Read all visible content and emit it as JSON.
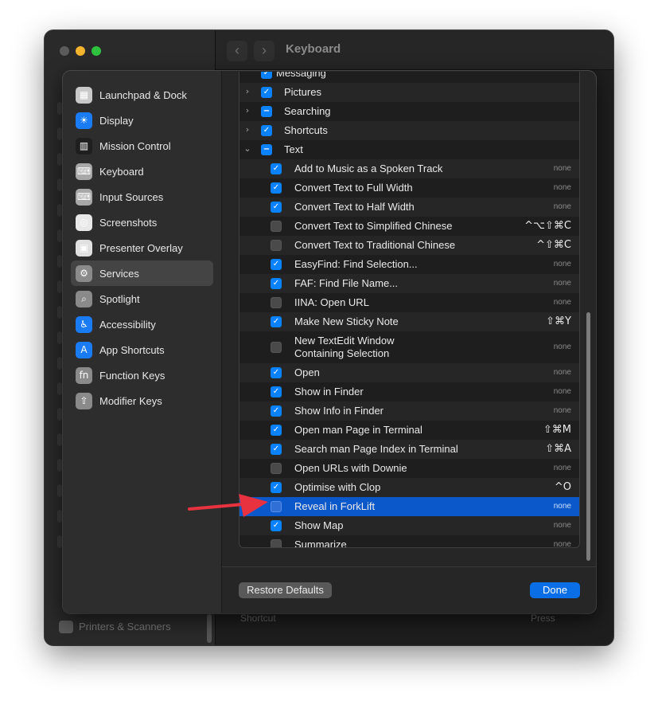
{
  "window": {
    "title": "Keyboard",
    "back_glyph": "‹",
    "forward_glyph": "›",
    "peek_shortcut_label": "Shortcut",
    "peek_press_label": "Press",
    "peek_printers_label": "Printers & Scanners"
  },
  "sidebar": {
    "items": [
      {
        "label": "Launchpad & Dock",
        "icon": "launchpad-dock-icon",
        "glyph": "▦",
        "color": "#c9c9c9"
      },
      {
        "label": "Display",
        "icon": "display-brightness-icon",
        "glyph": "☀",
        "color": "#1a7cf5"
      },
      {
        "label": "Mission Control",
        "icon": "mission-control-icon",
        "glyph": "▥",
        "color": "#1f1f1f"
      },
      {
        "label": "Keyboard",
        "icon": "keyboard-icon",
        "glyph": "⌨",
        "color": "#a8a8a8"
      },
      {
        "label": "Input Sources",
        "icon": "input-sources-icon",
        "glyph": "⌨",
        "color": "#a8a8a8"
      },
      {
        "label": "Screenshots",
        "icon": "screenshot-icon",
        "glyph": "◎",
        "color": "#e8e8e8"
      },
      {
        "label": "Presenter Overlay",
        "icon": "presenter-overlay-icon",
        "glyph": "▣",
        "color": "#e0e0e0"
      },
      {
        "label": "Services",
        "icon": "gears-icon",
        "glyph": "⚙",
        "color": "#8a8a8a"
      },
      {
        "label": "Spotlight",
        "icon": "spotlight-magnifier-icon",
        "glyph": "⌕",
        "color": "#8a8a8a"
      },
      {
        "label": "Accessibility",
        "icon": "accessibility-icon",
        "glyph": "♿",
        "color": "#1a7cf5"
      },
      {
        "label": "App Shortcuts",
        "icon": "app-shortcuts-icon",
        "glyph": "A",
        "color": "#1a7cf5"
      },
      {
        "label": "Function Keys",
        "icon": "function-keys-icon",
        "glyph": "fn",
        "color": "#8a8a8a"
      },
      {
        "label": "Modifier Keys",
        "icon": "modifier-keys-icon",
        "glyph": "⇧",
        "color": "#8a8a8a"
      }
    ],
    "selected_index": 7
  },
  "services_list": {
    "partial_top_label": "Messaging",
    "groups": [
      {
        "label": "Pictures",
        "state": "on",
        "expanded": false
      },
      {
        "label": "Searching",
        "state": "mixed",
        "expanded": false
      },
      {
        "label": "Shortcuts",
        "state": "on",
        "expanded": false
      },
      {
        "label": "Text",
        "state": "mixed",
        "expanded": true
      }
    ],
    "items": [
      {
        "label": "Add to Music as a Spoken Track",
        "checked": true,
        "shortcut": "none"
      },
      {
        "label": "Convert Text to Full Width",
        "checked": true,
        "shortcut": "none"
      },
      {
        "label": "Convert Text to Half Width",
        "checked": true,
        "shortcut": "none"
      },
      {
        "label": "Convert Text to Simplified Chinese",
        "checked": false,
        "shortcut": "^⌥⇧⌘C"
      },
      {
        "label": "Convert Text to Traditional Chinese",
        "checked": false,
        "shortcut": "^⇧⌘C"
      },
      {
        "label": "EasyFind: Find Selection...",
        "checked": true,
        "shortcut": "none"
      },
      {
        "label": "FAF: Find File Name...",
        "checked": true,
        "shortcut": "none"
      },
      {
        "label": "IINA: Open URL",
        "checked": false,
        "shortcut": "none"
      },
      {
        "label": "Make New Sticky Note",
        "checked": true,
        "shortcut": "⇧⌘Y"
      },
      {
        "label_line1": "New TextEdit Window",
        "label_line2": "Containing Selection",
        "checked": false,
        "shortcut": "none"
      },
      {
        "label": "Open",
        "checked": true,
        "shortcut": "none"
      },
      {
        "label": "Show in Finder",
        "checked": true,
        "shortcut": "none"
      },
      {
        "label": "Show Info in Finder",
        "checked": true,
        "shortcut": "none"
      },
      {
        "label": "Open man Page in Terminal",
        "checked": true,
        "shortcut": "⇧⌘M"
      },
      {
        "label": "Search man Page Index in Terminal",
        "checked": true,
        "shortcut": "⇧⌘A"
      },
      {
        "label": "Open URLs with Downie",
        "checked": false,
        "shortcut": "none"
      },
      {
        "label": "Optimise with Clop",
        "checked": true,
        "shortcut": "^O"
      },
      {
        "label": "Reveal in ForkLift",
        "checked": false,
        "shortcut": "none",
        "selected": true
      },
      {
        "label": "Show Map",
        "checked": true,
        "shortcut": "none"
      },
      {
        "label": "Summarize",
        "checked": false,
        "shortcut": "none"
      }
    ]
  },
  "footer": {
    "restore_label": "Restore Defaults",
    "done_label": "Done"
  },
  "annotation": {
    "arrow_color": "#e8323f"
  }
}
